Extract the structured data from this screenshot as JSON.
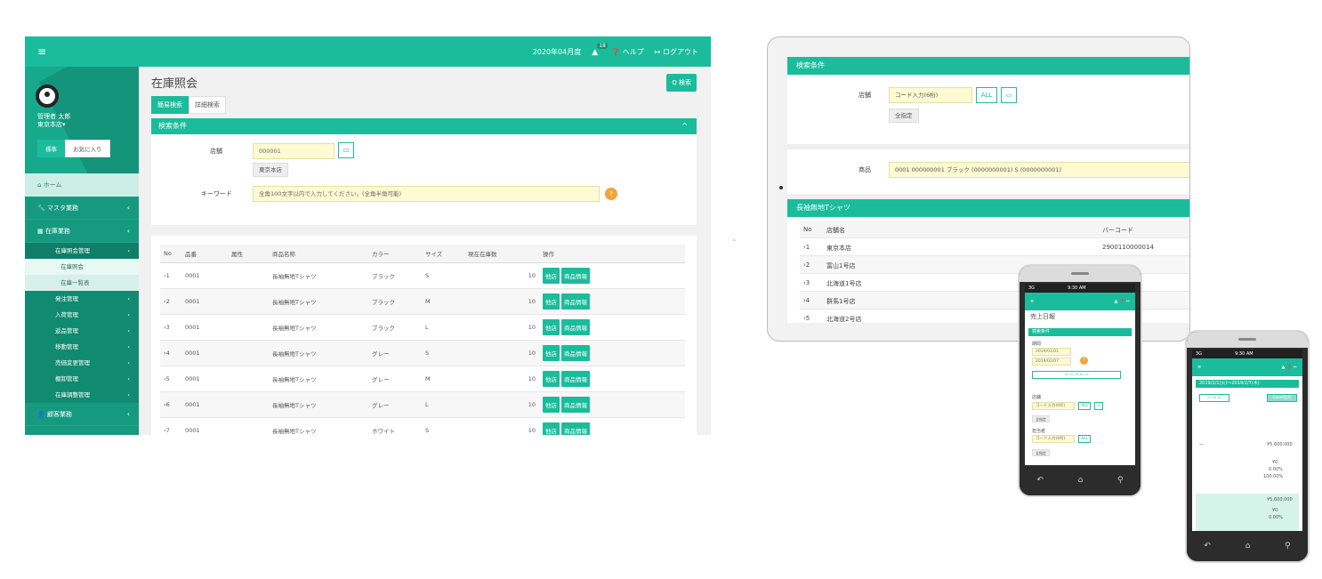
{
  "desktop": {
    "header": {
      "date": "2020年04月度",
      "badge": "18",
      "help": "ヘルプ",
      "logout": "ログアウト"
    },
    "sidebar": {
      "user_name": "管理者 太郎",
      "store": "東京本店▾",
      "tab_standard": "標準",
      "tab_favorite": "お気に入り",
      "home": "ホーム",
      "master": "マスタ業務",
      "inventory": "在庫業務",
      "sub_inquiry": "在庫照会管理",
      "leaf_inquiry": "在庫照会",
      "leaf_list": "在庫一覧表",
      "order": "発注管理",
      "receiving": "入荷管理",
      "returns": "返品管理",
      "transfer": "移動管理",
      "price_change": "売価変更管理",
      "stocktake": "棚卸管理",
      "adjust": "在庫調整管理",
      "customer": "顧客業務"
    },
    "page_title": "在庫照会",
    "search_button": "Q 検索",
    "tabs": [
      "簡易検索",
      "詳細検索"
    ],
    "conditions": {
      "title": "検索条件",
      "store_label": "店舗",
      "store_value": "000001",
      "store_name": "東京本店",
      "keyword_label": "キーワード",
      "keyword_placeholder": "全角100文字以内で入力してください。(全角半角可能)",
      "help_icon": "?"
    },
    "table": {
      "headers": [
        "No",
        "品番",
        "属性",
        "商品名称",
        "カラー",
        "サイズ",
        "現在在庫数",
        "操作"
      ],
      "rows": [
        [
          "›1",
          "0001",
          "",
          "長袖無地Tシャツ",
          "ブラック",
          "S",
          "10"
        ],
        [
          "›2",
          "0001",
          "",
          "長袖無地Tシャツ",
          "ブラック",
          "M",
          "10"
        ],
        [
          "›3",
          "0001",
          "",
          "長袖無地Tシャツ",
          "ブラック",
          "L",
          "10"
        ],
        [
          "›4",
          "0001",
          "",
          "長袖無地Tシャツ",
          "グレー",
          "S",
          "10"
        ],
        [
          "›5",
          "0001",
          "",
          "長袖無地Tシャツ",
          "グレー",
          "M",
          "10"
        ],
        [
          "›6",
          "0001",
          "",
          "長袖無地Tシャツ",
          "グレー",
          "L",
          "10"
        ],
        [
          "›7",
          "0001",
          "",
          "長袖無地Tシャツ",
          "ホワイト",
          "S",
          "10"
        ]
      ],
      "btn_other_store": "他店",
      "btn_product_info": "商品情報"
    }
  },
  "tablet": {
    "conditions_title": "検索条件",
    "store_label": "店舗",
    "store_placeholder": "コード入力(6桁)",
    "all_button": "ALL",
    "select_all": "全指定",
    "product_label": "商品",
    "product_value": "0001 000000001 ブラック (0000000001) S (0000000001)",
    "section_title": "長袖無地Tシャツ",
    "headers": [
      "No",
      "店舗名",
      "バーコード"
    ],
    "rows": [
      [
        "›1",
        "東京本店",
        "2900110000014"
      ],
      [
        "›2",
        "富山1号店",
        ""
      ],
      [
        "›3",
        "北海道1号店",
        ""
      ],
      [
        "›4",
        "群馬1号店",
        ""
      ],
      [
        "›5",
        "北海道2号店",
        ""
      ]
    ]
  },
  "phone1": {
    "status_left": "3G",
    "time": "9:30 AM",
    "page": "売上日報",
    "conditions": "検索条件",
    "date_label": "期間",
    "date_from": "2019/01/01",
    "date_to": "2019/02/07",
    "store": "店舗",
    "code_placeholder": "コード入力(6桁)",
    "all_button": "ALL",
    "select_all": "全指定",
    "staff": "担当者"
  },
  "phone2": {
    "status_left": "3G",
    "time": "9:30 AM",
    "range": "2019/1/1(火)〜2019/2/7(木)",
    "total": "¥5,600,000",
    "amount": "¥0",
    "rate": "0.00%",
    "rate_full": "100.00%",
    "excel": "Excel出力"
  },
  "colors": {
    "accent": "#1bbc9b",
    "accent_dark": "#159a80",
    "input_bg": "#fefad2",
    "warn": "#f0a43a"
  }
}
